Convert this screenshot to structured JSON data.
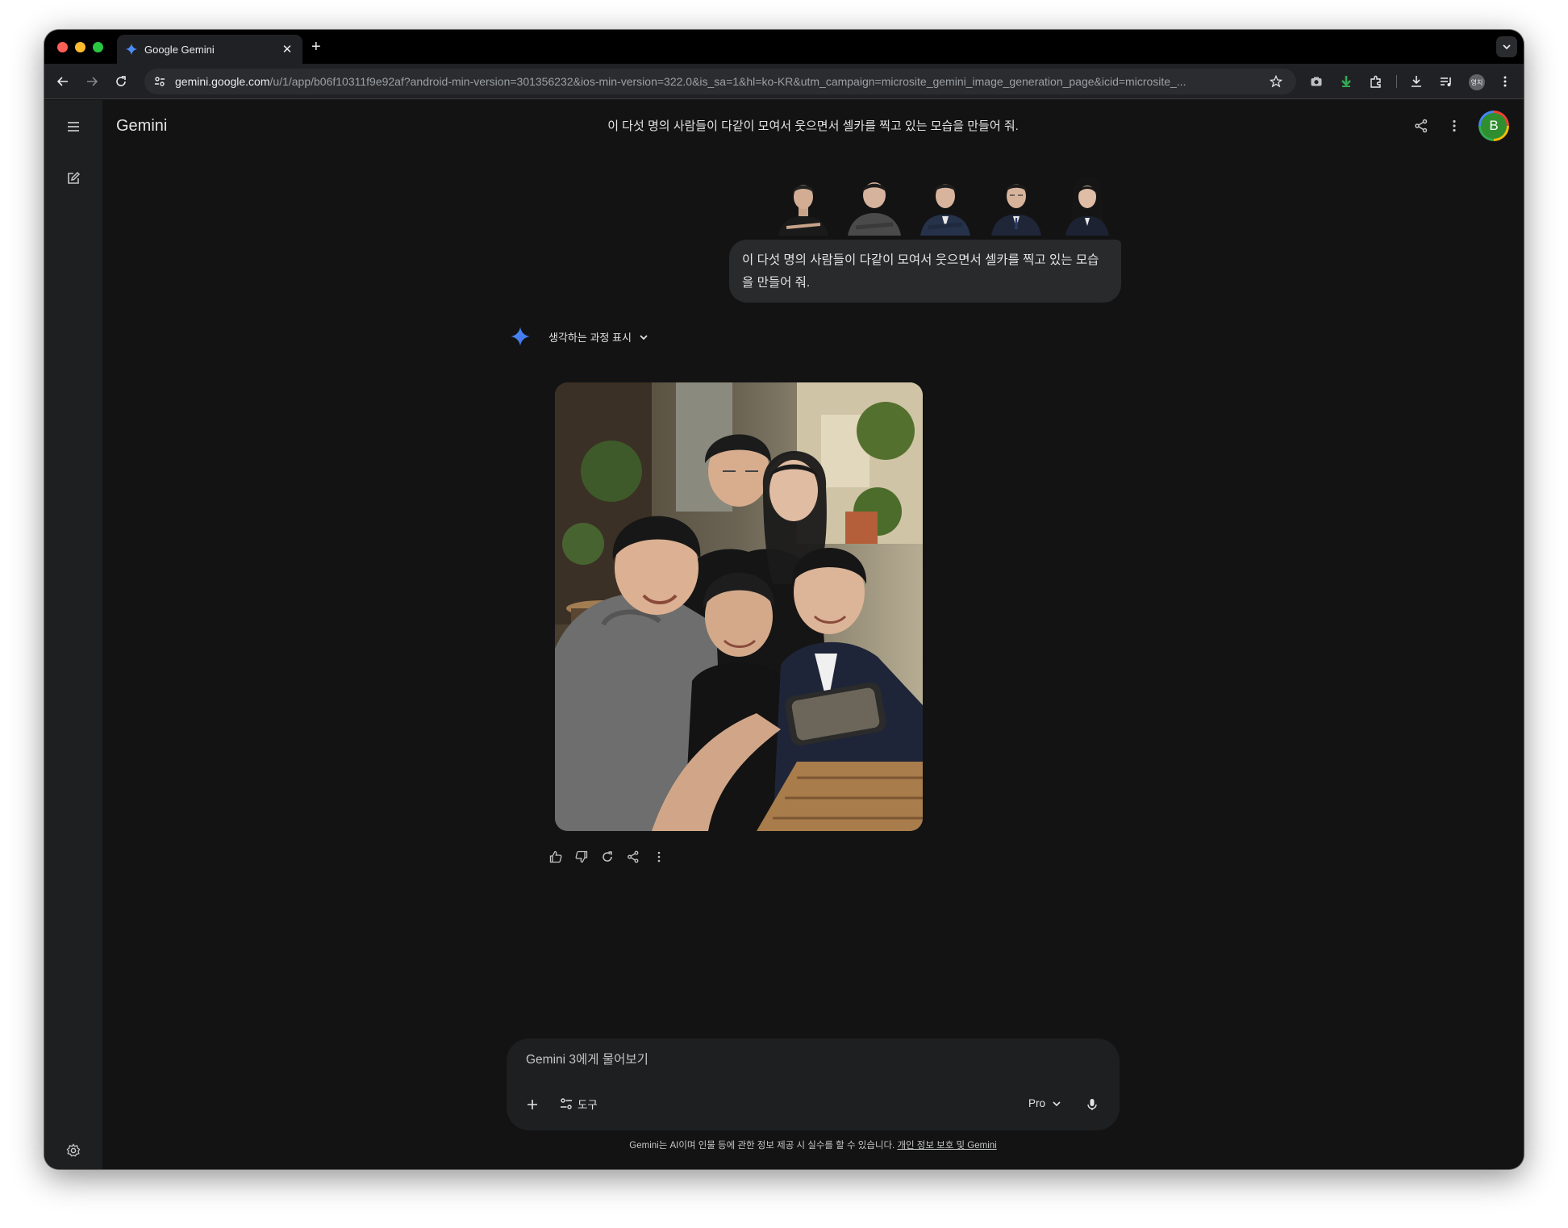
{
  "browser": {
    "tab_title": "Google Gemini",
    "new_tab": "+",
    "tab_close": "✕",
    "url_domain": "gemini.google.com",
    "url_path": "/u/1/app/b06f10311f9e92af?android-min-version=301356232&ios-min-version=322.0&is_sa=1&hl=ko-KR&utm_campaign=microsite_gemini_image_generation_page&icid=microsite_...",
    "profile_label": "영치"
  },
  "app": {
    "title": "Gemini",
    "conversation_title": "이 다섯 명의 사람들이 다같이 모여서 웃으면서 셀카를 찍고 있는 모습을 만들어 줘.",
    "avatar_letter": "B",
    "accent_color": "#4285f4"
  },
  "chat": {
    "user_message": "이 다섯 명의 사람들이 다같이 모여서 웃으면서 셀카를 찍고 있는 모습을 만들어 줘.",
    "attachments": [
      "person-1",
      "person-2",
      "person-3",
      "person-4",
      "person-5"
    ],
    "thinking_label": "생각하는 과정 표시",
    "response_image": "group-selfie-image",
    "actions": [
      "thumb-up-icon",
      "thumb-down-icon",
      "regenerate-icon",
      "share-icon",
      "more-icon"
    ]
  },
  "input": {
    "placeholder": "Gemini 3에게 물어보기",
    "tools_label": "도구",
    "model_label": "Pro"
  },
  "footer": {
    "disclaimer": "Gemini는 AI이며 인물 등에 관한 정보 제공 시 실수를 할 수 있습니다. ",
    "link": "개인 정보 보호 및 Gemini"
  }
}
